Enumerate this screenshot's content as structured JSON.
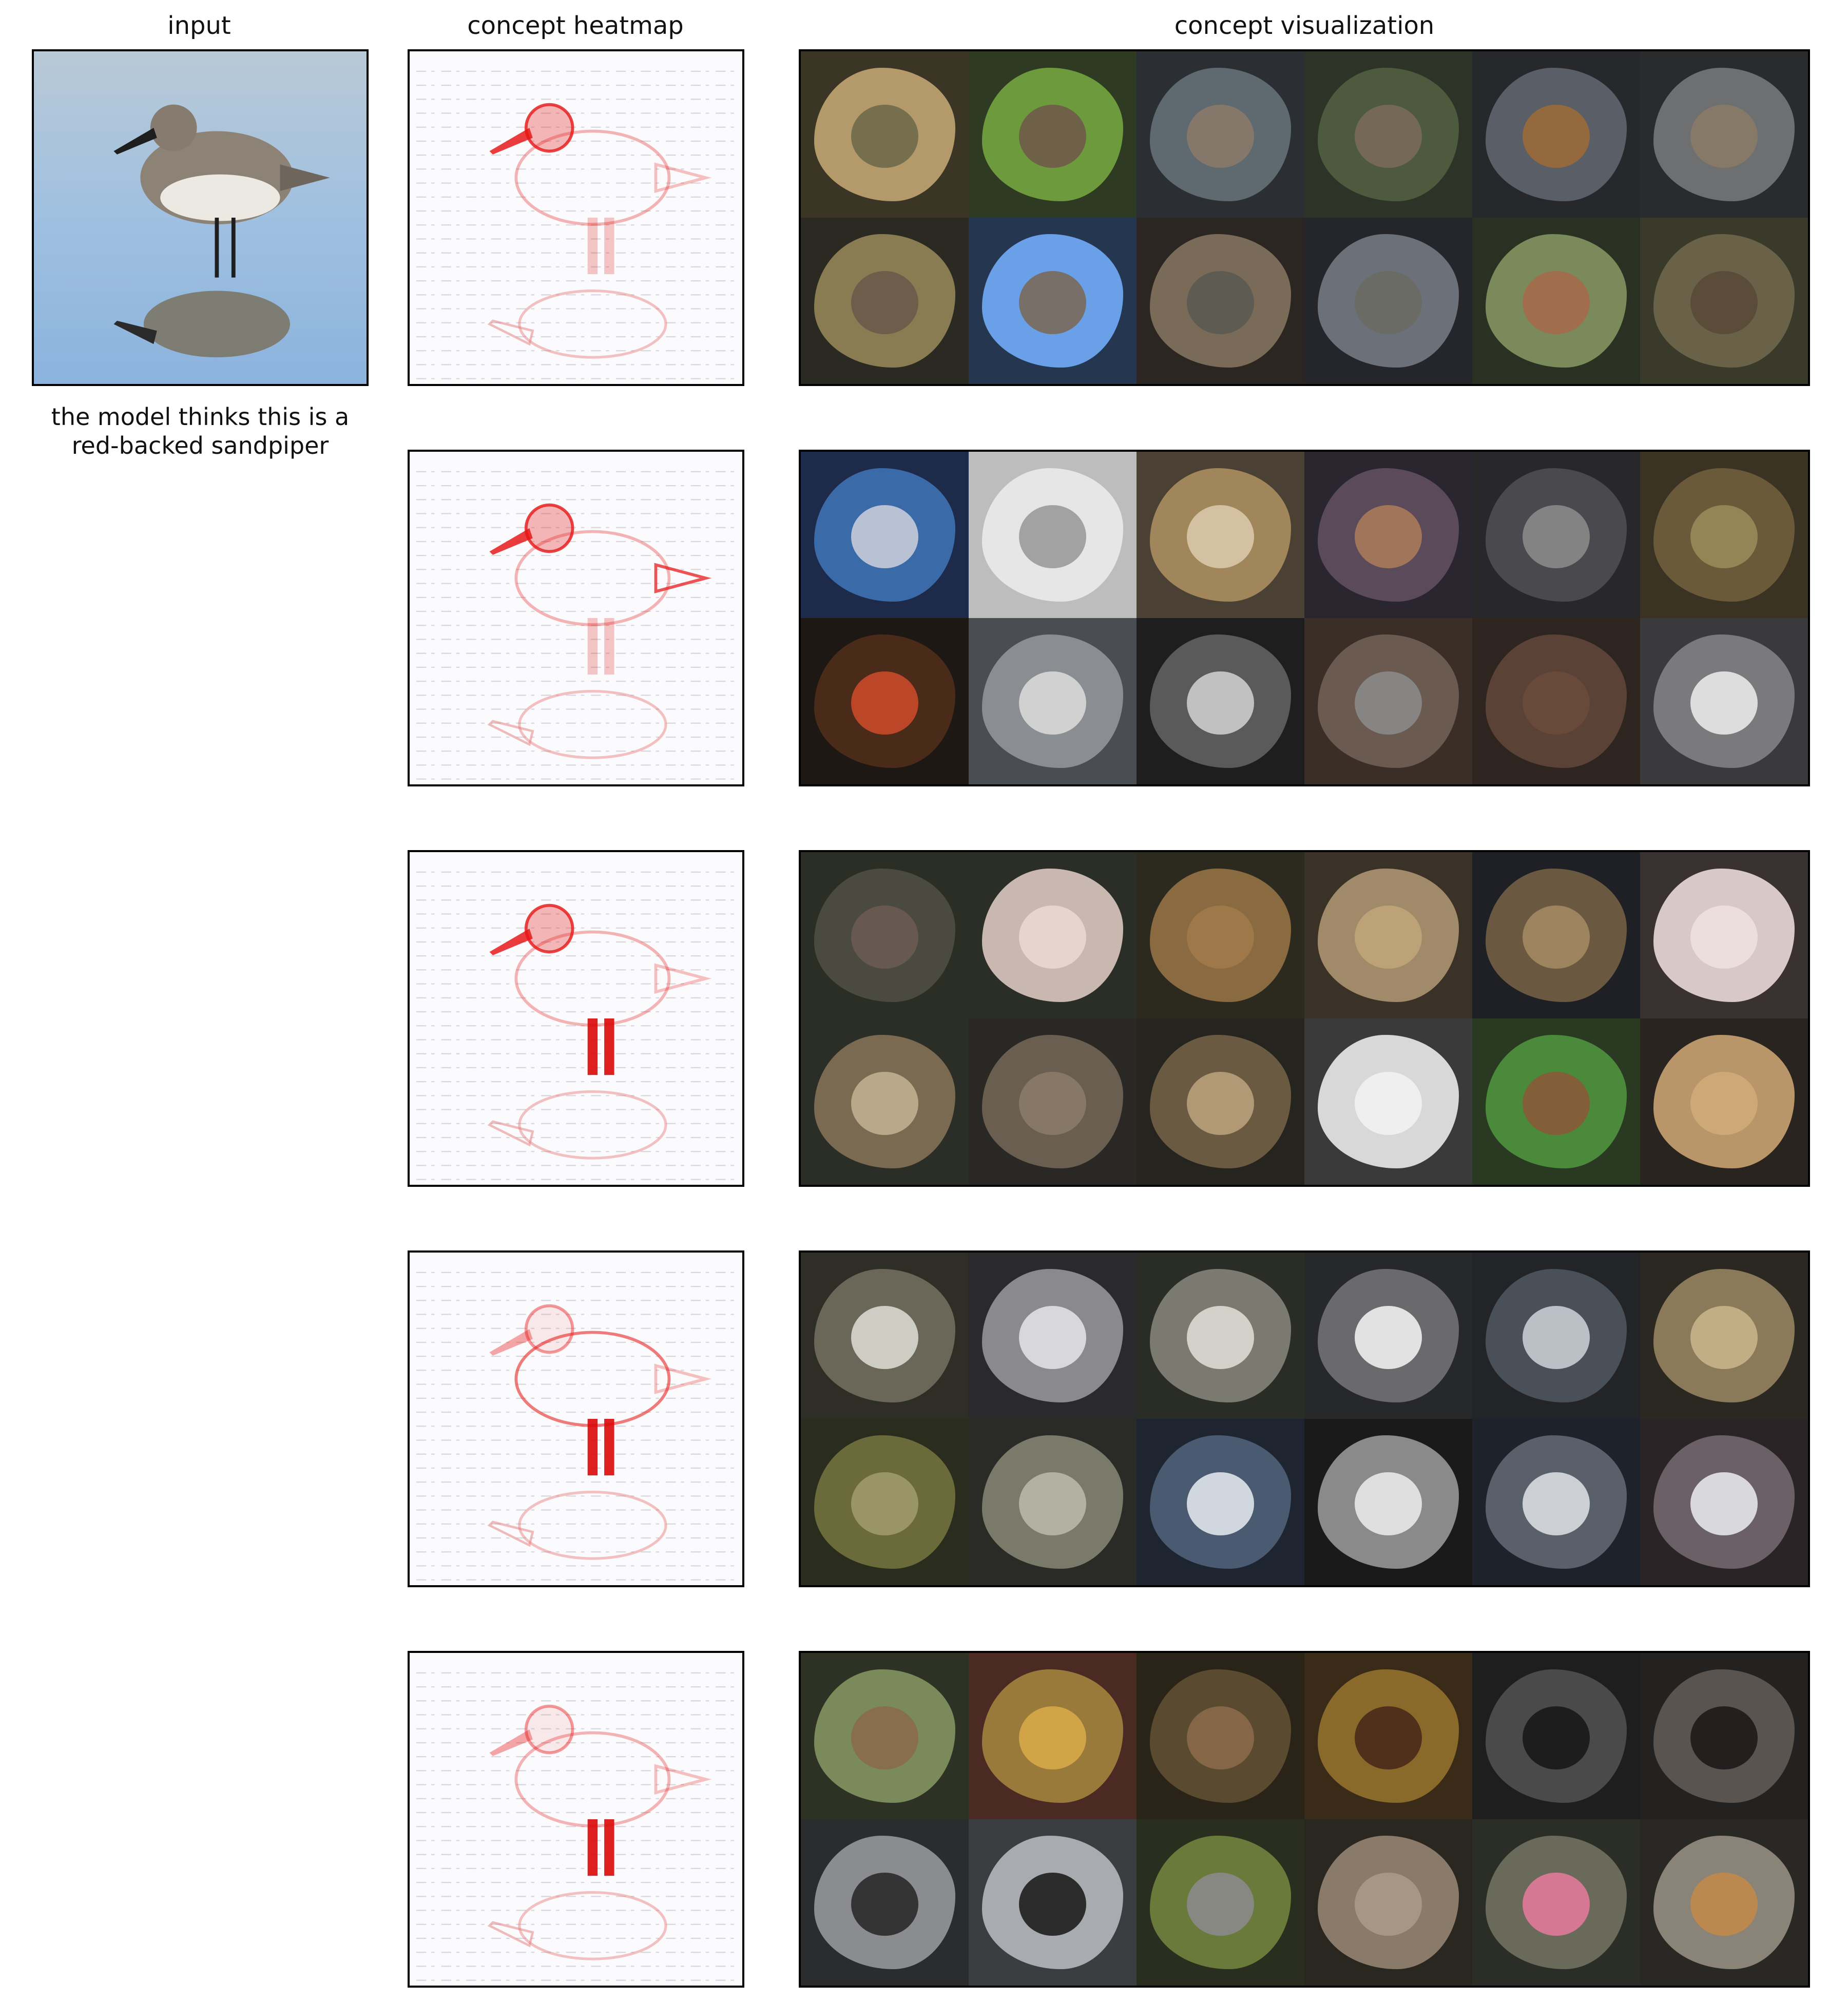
{
  "headers": {
    "input": "input",
    "heatmap": "concept heatmap",
    "visualization": "concept visualization"
  },
  "caption": {
    "line1": "the model thinks this is a",
    "line2": "red-backed sandpiper"
  },
  "concepts": [
    {
      "heat_focus": "bird head and beak",
      "tiles": [
        {
          "bg": "#3b3526",
          "blob": "#b49a6a",
          "subject": "#6f6a4a"
        },
        {
          "bg": "#2f3a22",
          "blob": "#6d9a3c",
          "subject": "#6e5b48"
        },
        {
          "bg": "#2b2f33",
          "blob": "#5f6a70",
          "subject": "#8a7a6a"
        },
        {
          "bg": "#2d3326",
          "blob": "#4e5a3e",
          "subject": "#7a6a58"
        },
        {
          "bg": "#26282c",
          "blob": "#5a5e66",
          "subject": "#9a6a3a"
        },
        {
          "bg": "#2a2b2c",
          "blob": "#6e6f70",
          "subject": "#8a7a66"
        },
        {
          "bg": "#2a2a22",
          "blob": "#8a7c52",
          "subject": "#6a5a4a"
        },
        {
          "bg": "#243650",
          "blob": "#6aa0e8",
          "subject": "#7a6a5a"
        },
        {
          "bg": "#2b2622",
          "blob": "#7a6a58",
          "subject": "#5a5a52"
        },
        {
          "bg": "#24262b",
          "blob": "#6c7078",
          "subject": "#6a6a62"
        },
        {
          "bg": "#2a3022",
          "blob": "#7a8a5a",
          "subject": "#a46a4a"
        },
        {
          "bg": "#3a3a2a",
          "blob": "#6a6248",
          "subject": "#5a4a38"
        }
      ]
    },
    {
      "heat_focus": "head and tail",
      "tiles": [
        {
          "bg": "#1e2a4a",
          "blob": "#3a6aa8",
          "subject": "#c8ccd8"
        },
        {
          "bg": "#bdbdbd",
          "blob": "#e6e6e6",
          "subject": "#9a9a9a"
        },
        {
          "bg": "#4a4034",
          "blob": "#a0865a",
          "subject": "#d8c8a8"
        },
        {
          "bg": "#2a2630",
          "blob": "#5a4a5a",
          "subject": "#a87a5a"
        },
        {
          "bg": "#28282a",
          "blob": "#4a4a4e",
          "subject": "#8a8a8a"
        },
        {
          "bg": "#3a3222",
          "blob": "#6a5a3a",
          "subject": "#9a8a5a"
        },
        {
          "bg": "#1e1814",
          "blob": "#4a2a18",
          "subject": "#c84a2a"
        },
        {
          "bg": "#4a4e52",
          "blob": "#8a8e92",
          "subject": "#d8d8d8"
        },
        {
          "bg": "#1e1e1e",
          "blob": "#5a5a5a",
          "subject": "#cccccc"
        },
        {
          "bg": "#3a2e26",
          "blob": "#6a5a50",
          "subject": "#8a8a88"
        },
        {
          "bg": "#2e2420",
          "blob": "#5a4236",
          "subject": "#6a4a3a"
        },
        {
          "bg": "#3a3a3c",
          "blob": "#7a7a7c",
          "subject": "#e8e8e8"
        }
      ]
    },
    {
      "heat_focus": "bird head and legs",
      "tiles": [
        {
          "bg": "#2a2e24",
          "blob": "#4a4a40",
          "subject": "#6a5a52"
        },
        {
          "bg": "#2a2e26",
          "blob": "#c8b8b0",
          "subject": "#e8d8d0"
        },
        {
          "bg": "#2c2a1e",
          "blob": "#8a6a40",
          "subject": "#a07a4a"
        },
        {
          "bg": "#3a3226",
          "blob": "#a08a6a",
          "subject": "#c0a47a"
        },
        {
          "bg": "#1e2026",
          "blob": "#6a5840",
          "subject": "#a48a62"
        },
        {
          "bg": "#3a3230",
          "blob": "#d8c8c8",
          "subject": "#f0e0e0"
        },
        {
          "bg": "#2a2e26",
          "blob": "#7a6a52",
          "subject": "#c0b090"
        },
        {
          "bg": "#2a2824",
          "blob": "#6a5e50",
          "subject": "#8a7a68"
        },
        {
          "bg": "#26241e",
          "blob": "#6a5a42",
          "subject": "#b8a07a"
        },
        {
          "bg": "#3a3a3a",
          "blob": "#d8d8d8",
          "subject": "#f2f2f2"
        },
        {
          "bg": "#2a3a22",
          "blob": "#4a8a3a",
          "subject": "#8a5a3a"
        },
        {
          "bg": "#2a2420",
          "blob": "#b8966a",
          "subject": "#d0aa78"
        }
      ]
    },
    {
      "heat_focus": "body and legs",
      "tiles": [
        {
          "bg": "#2e2e26",
          "blob": "#6a6658",
          "subject": "#d8d8d0"
        },
        {
          "bg": "#2a2a2c",
          "blob": "#8a8a8e",
          "subject": "#e0e0e4"
        },
        {
          "bg": "#2a2c26",
          "blob": "#7a7a70",
          "subject": "#dcdcd4"
        },
        {
          "bg": "#26282a",
          "blob": "#6a6a6c",
          "subject": "#f0f0f0"
        },
        {
          "bg": "#222428",
          "blob": "#4a5058",
          "subject": "#c8ccd4"
        },
        {
          "bg": "#2a2820",
          "blob": "#8a7a5a",
          "subject": "#c8b48a"
        },
        {
          "bg": "#2a2c1e",
          "blob": "#6a6a3a",
          "subject": "#a09a6a"
        },
        {
          "bg": "#2a2a26",
          "blob": "#7a7a6a",
          "subject": "#b8b8aa"
        },
        {
          "bg": "#1e2430",
          "blob": "#4a5a70",
          "subject": "#e0e4ea"
        },
        {
          "bg": "#1a1a1a",
          "blob": "#8a8a8a",
          "subject": "#e8e8e8"
        },
        {
          "bg": "#1e222a",
          "blob": "#5a606a",
          "subject": "#d8dce0"
        },
        {
          "bg": "#2a2426",
          "blob": "#6a6066",
          "subject": "#e6e6ea"
        }
      ]
    },
    {
      "heat_focus": "legs",
      "tiles": [
        {
          "bg": "#2e3224",
          "blob": "#7a8a5a",
          "subject": "#8a6a4a"
        },
        {
          "bg": "#4a2a22",
          "blob": "#9a7a3a",
          "subject": "#d8a84a"
        },
        {
          "bg": "#2a2418",
          "blob": "#5a4a30",
          "subject": "#8a6a4a"
        },
        {
          "bg": "#3a2a18",
          "blob": "#8a6a2a",
          "subject": "#4a2a1a"
        },
        {
          "bg": "#1e1e1e",
          "blob": "#4a4a4a",
          "subject": "#181818"
        },
        {
          "bg": "#242220",
          "blob": "#5a5450",
          "subject": "#1e1a18"
        },
        {
          "bg": "#2a2c2e",
          "blob": "#8a8c90",
          "subject": "#2a2a2a"
        },
        {
          "bg": "#3a3e40",
          "blob": "#a8acb0",
          "subject": "#1e1e1e"
        },
        {
          "bg": "#2a2e1e",
          "blob": "#6a7a3a",
          "subject": "#8a8a8a"
        },
        {
          "bg": "#2a2620",
          "blob": "#8a7a6a",
          "subject": "#a89a88"
        },
        {
          "bg": "#2a2e26",
          "blob": "#6a6a5a",
          "subject": "#e07a9a"
        },
        {
          "bg": "#2a2824",
          "blob": "#8a8478",
          "subject": "#c08a4a"
        }
      ]
    }
  ]
}
